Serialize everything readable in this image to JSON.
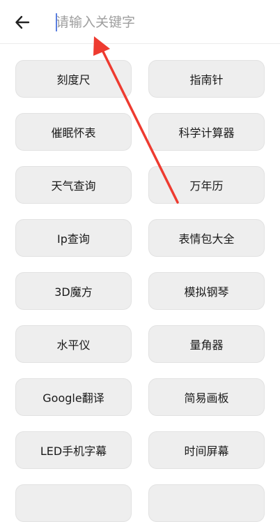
{
  "search": {
    "placeholder": "请输入关键字",
    "value": ""
  },
  "tools": [
    "刻度尺",
    "指南针",
    "催眠怀表",
    "科学计算器",
    "天气查询",
    "万年历",
    "Ip查询",
    "表情包大全",
    "3D魔方",
    "模拟钢琴",
    "水平仪",
    "量角器",
    "Google翻译",
    "简易画板",
    "LED手机字幕",
    "时间屏幕",
    "",
    ""
  ],
  "annotation": {
    "color": "#ee3b30"
  }
}
